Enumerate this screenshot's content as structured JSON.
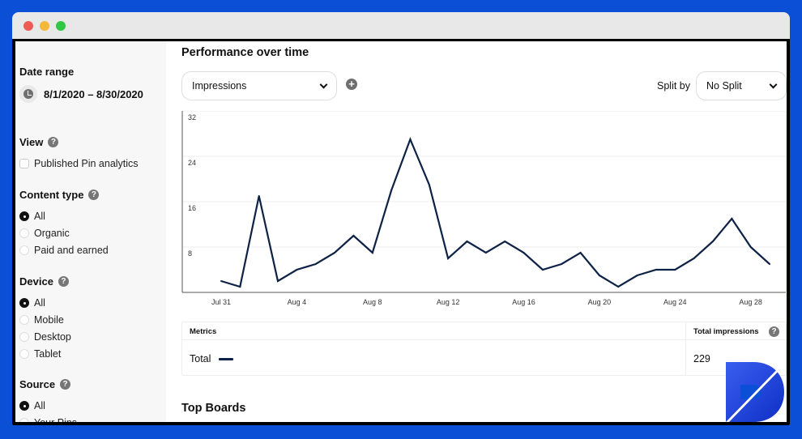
{
  "window": {
    "traffic_lights": [
      "close",
      "minimize",
      "maximize"
    ]
  },
  "sidebar": {
    "date_range": {
      "title": "Date range",
      "icon": "clock-icon",
      "value": "8/1/2020 – 8/30/2020"
    },
    "view": {
      "title": "View",
      "help": "?",
      "checkbox_label": "Published Pin analytics",
      "checked": false
    },
    "content_type": {
      "title": "Content type",
      "help": "?",
      "options": [
        "All",
        "Organic",
        "Paid and earned"
      ],
      "selected": "All"
    },
    "device": {
      "title": "Device",
      "help": "?",
      "options": [
        "All",
        "Mobile",
        "Desktop",
        "Tablet"
      ],
      "selected": "All"
    },
    "source": {
      "title": "Source",
      "help": "?",
      "options": [
        "All",
        "Your Pins"
      ],
      "selected": "All"
    }
  },
  "main": {
    "title": "Performance over time",
    "metric_select": {
      "value": "Impressions"
    },
    "add_metric": "+",
    "split_label": "Split by",
    "split_select": {
      "value": "No Split"
    },
    "metrics_table": {
      "header_left": "Metrics",
      "header_right": "Total impressions",
      "help": "?",
      "row_label": "Total",
      "row_value": "229"
    },
    "section2_title": "Top Boards"
  },
  "colors": {
    "line": "#0e2246",
    "background": "#0a4fd6",
    "logo": "#1b3fd8"
  },
  "chart_data": {
    "type": "line",
    "title": "",
    "xlabel": "",
    "ylabel": "",
    "ylim": [
      0,
      32
    ],
    "yticks": [
      8,
      16,
      24,
      32
    ],
    "grid": true,
    "x": [
      "Jul 31",
      "Aug 1",
      "Aug 2",
      "Aug 3",
      "Aug 4",
      "Aug 5",
      "Aug 6",
      "Aug 7",
      "Aug 8",
      "Aug 9",
      "Aug 10",
      "Aug 11",
      "Aug 12",
      "Aug 13",
      "Aug 14",
      "Aug 15",
      "Aug 16",
      "Aug 17",
      "Aug 18",
      "Aug 19",
      "Aug 20",
      "Aug 21",
      "Aug 22",
      "Aug 23",
      "Aug 24",
      "Aug 25",
      "Aug 26",
      "Aug 27",
      "Aug 28",
      "Aug 29"
    ],
    "xtick_labels": [
      "Jul 31",
      "Aug 4",
      "Aug 8",
      "Aug 12",
      "Aug 16",
      "Aug 20",
      "Aug 24",
      "Aug 28"
    ],
    "series": [
      {
        "name": "Total",
        "values": [
          2,
          1,
          17,
          2,
          4,
          5,
          7,
          10,
          7,
          18,
          27,
          19,
          6,
          9,
          7,
          9,
          7,
          4,
          5,
          7,
          3,
          1,
          3,
          4,
          4,
          6,
          9,
          13,
          8,
          5
        ]
      }
    ]
  }
}
